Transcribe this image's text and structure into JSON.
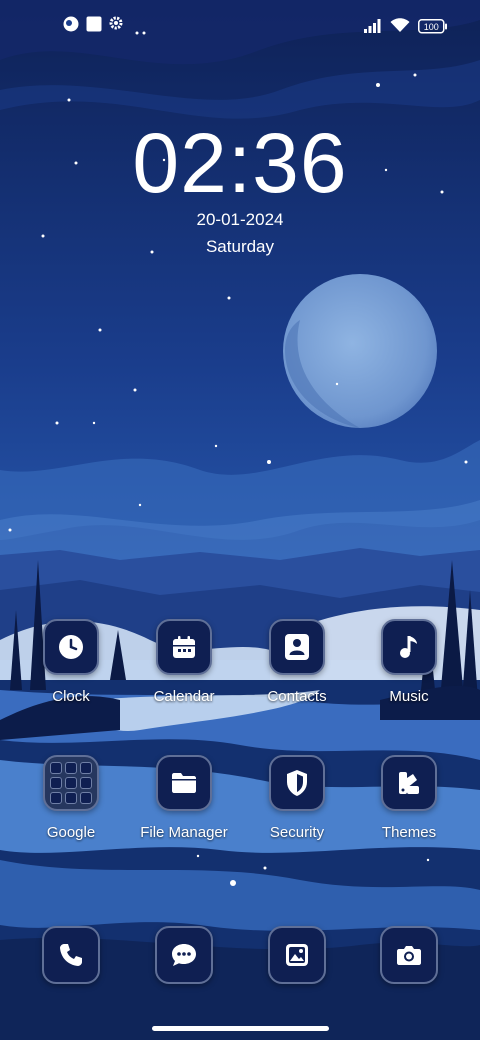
{
  "status_bar": {
    "left_icons": [
      "profile-dot-icon",
      "screenshot-square-icon",
      "settings-gear-icon",
      "more-dots-icon"
    ],
    "right_icons": [
      "cellular-signal-icon",
      "wifi-icon",
      "battery-icon"
    ],
    "battery": "100"
  },
  "lockclock": {
    "time": "02:36",
    "date": "20-01-2024",
    "day": "Saturday"
  },
  "apps": [
    {
      "label": "Clock",
      "icon": "clock-icon"
    },
    {
      "label": "Calendar",
      "icon": "calendar-icon"
    },
    {
      "label": "Contacts",
      "icon": "contacts-icon"
    },
    {
      "label": "Music",
      "icon": "music-note-icon"
    },
    {
      "label": "Google",
      "icon": "google-folder-icon"
    },
    {
      "label": "File Manager",
      "icon": "folder-icon"
    },
    {
      "label": "Security",
      "icon": "shield-icon"
    },
    {
      "label": "Themes",
      "icon": "themes-icon"
    }
  ],
  "dock": [
    {
      "icon": "phone-icon"
    },
    {
      "icon": "messages-icon"
    },
    {
      "icon": "gallery-icon"
    },
    {
      "icon": "camera-icon"
    }
  ],
  "colors": {
    "sky_top": "#10245e",
    "sky_mid": "#1f4a9e",
    "moon": "#9fc0e8",
    "tile_bg": "#0f1f52",
    "tile_border": "#5f6f97"
  }
}
